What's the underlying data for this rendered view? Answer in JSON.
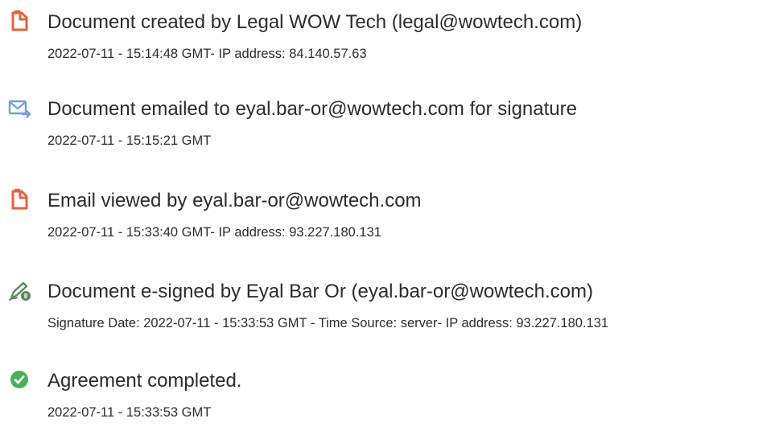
{
  "events": [
    {
      "icon": "document-icon",
      "title": "Document created by Legal WOW Tech (legal@wowtech.com)",
      "detail": "2022-07-11 - 15:14:48 GMT- IP address: 84.140.57.63"
    },
    {
      "icon": "email-sent-icon",
      "title": "Document emailed to eyal.bar-or@wowtech.com for signature",
      "detail": "2022-07-11 - 15:15:21 GMT"
    },
    {
      "icon": "document-icon",
      "title": "Email viewed by eyal.bar-or@wowtech.com",
      "detail": "2022-07-11 - 15:33:40 GMT- IP address: 93.227.180.131"
    },
    {
      "icon": "e-sign-pen-icon",
      "title": "Document e-signed by Eyal Bar Or (eyal.bar-or@wowtech.com)",
      "detail": "Signature Date: 2022-07-11 - 15:33:53 GMT - Time Source: server- IP address: 93.227.180.131"
    },
    {
      "icon": "check-circle-icon",
      "title": "Agreement completed.",
      "detail": "2022-07-11 - 15:33:53 GMT"
    }
  ],
  "colors": {
    "text": "#2c2c2c",
    "document_icon": "#e8613c",
    "email_icon": "#6f9fd8",
    "sign_icon": "#5a8a5e",
    "check_icon": "#46b058"
  }
}
